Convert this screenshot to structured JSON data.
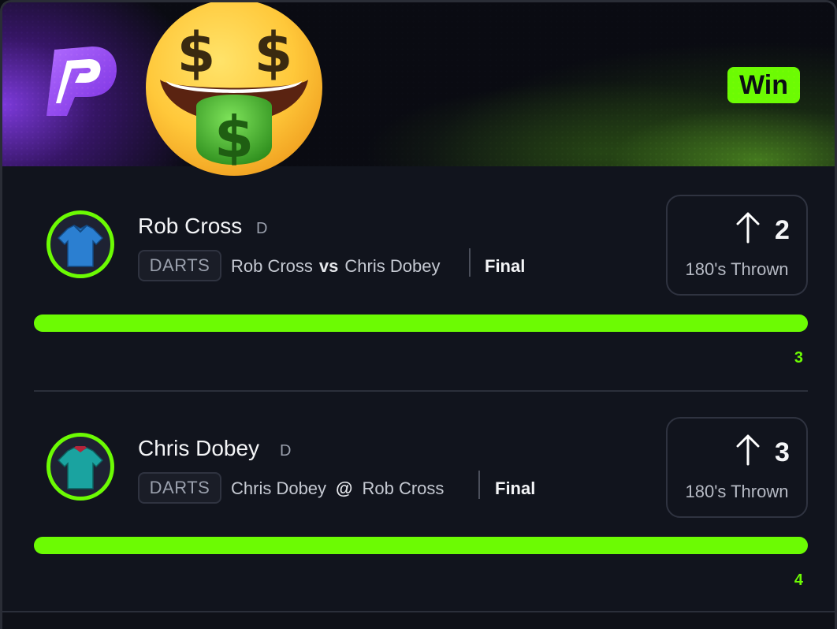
{
  "header": {
    "result_badge": "Win",
    "colors": {
      "accent": "#6cfb03",
      "brand": "#8a3ff0"
    }
  },
  "players": [
    {
      "name": "Rob Cross",
      "position": "D",
      "sport": "DARTS",
      "matchup_team": "Rob Cross",
      "matchup_sep": "vs",
      "matchup_opponent": "Chris Dobey",
      "status": "Final",
      "direction": "up",
      "line": "2",
      "stat_label": "180's Thrown",
      "result_value": "3",
      "progress_fraction": 1.0,
      "jersey_color": "#2b7fd1"
    },
    {
      "name": "Chris Dobey",
      "position": "D",
      "sport": "DARTS",
      "matchup_team": "Chris Dobey",
      "matchup_sep": "@",
      "matchup_opponent": "Rob Cross",
      "status": "Final",
      "direction": "up",
      "line": "3",
      "stat_label": "180's Thrown",
      "result_value": "4",
      "progress_fraction": 1.0,
      "jersey_color": "#1aa3a0"
    }
  ]
}
